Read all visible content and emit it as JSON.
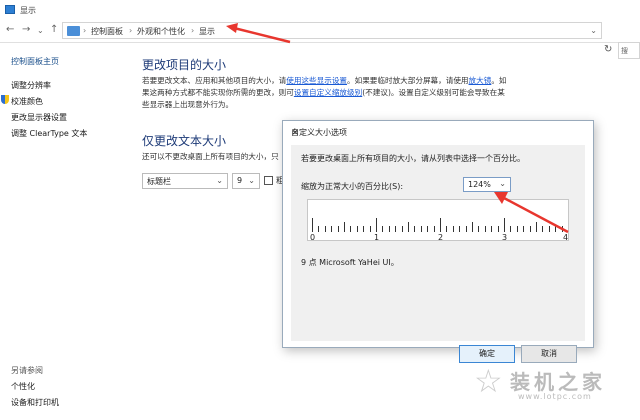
{
  "window": {
    "title": "显示"
  },
  "address": {
    "crumbs": [
      "控制面板",
      "外观和个性化",
      "显示"
    ]
  },
  "search": {
    "placeholder": "搜"
  },
  "sidebar": {
    "home": "控制面板主页",
    "items": [
      "调整分辨率",
      "校准颜色",
      "更改显示器设置",
      "调整 ClearType 文本"
    ],
    "see_also_title": "另请参阅",
    "see_also": [
      "个性化",
      "设备和打印机"
    ]
  },
  "section1": {
    "title": "更改项目的大小",
    "line1_a": "若要更改文本、应用和其他项目的大小，请",
    "line1_link": "使用这些显示设置",
    "line1_b": "。如果要临时放大部分屏幕，请使用",
    "line1_link2": "放大镜",
    "line1_c": "。如",
    "line2_a": "果这两种方式都不能实现你所需的更改，则可",
    "line2_link": "设置自定义缩放级别",
    "line2_b": "(不建议)。设置自定义级别可能会导致在某",
    "line3": "些显示器上出现意外行为。"
  },
  "section2": {
    "title": "仅更改文本大小",
    "desc": "还可以不更改桌面上所有项目的大小，只",
    "item_select": "标题栏",
    "size_select": "9",
    "bold_label": "粗"
  },
  "dialog": {
    "title": "自定义大小选项",
    "close": "×",
    "instruction": "若要更改桌面上所有项目的大小，请从列表中选择一个百分比。",
    "scale_label": "缩放为正常大小的百分比(S):",
    "scale_value": "124%",
    "ruler_labels": [
      "0",
      "1",
      "2",
      "3",
      "4"
    ],
    "sample": "9 点 Microsoft YaHei UI。",
    "ok": "确定",
    "cancel": "取消"
  },
  "watermark": {
    "brand": "装机之家",
    "url": "www.lotpc.com"
  },
  "colors": {
    "accent_link": "#1a5ad4",
    "heading": "#1e3b78",
    "arrow": "#e8362e"
  }
}
